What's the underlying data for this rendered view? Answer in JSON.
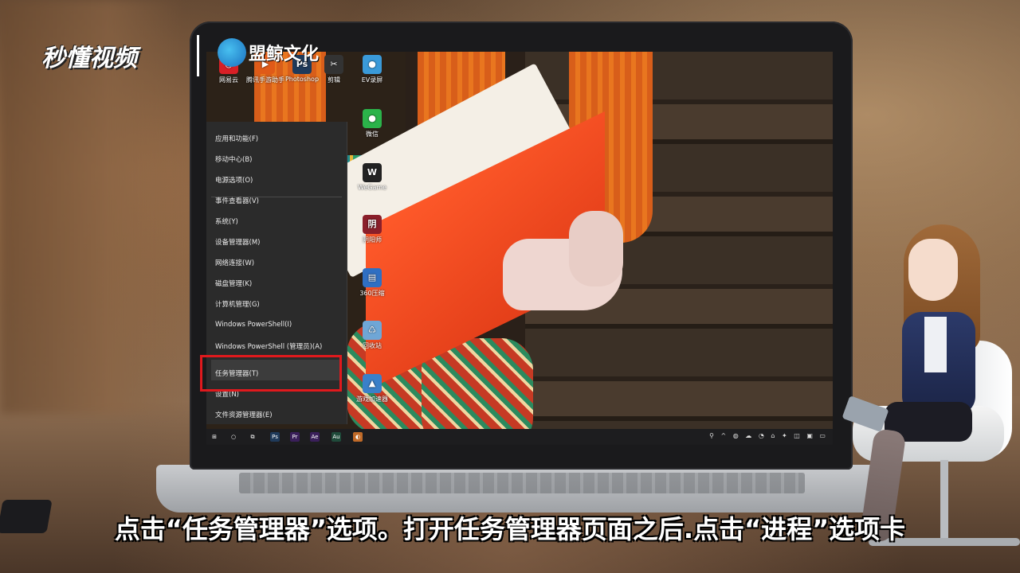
{
  "branding": {
    "logo_text": "秒懂视频",
    "partner_text": "盟鲸文化"
  },
  "desktop_icons": [
    {
      "label": "网易云",
      "glyph": "◎",
      "color": "#d81f26"
    },
    {
      "label": "腾讯手游助手",
      "glyph": "▶",
      "color": "#e05a18"
    },
    {
      "label": "Photoshop",
      "glyph": "Ps",
      "color": "#1f3a5a"
    },
    {
      "label": "剪辑",
      "glyph": "✂",
      "color": "#333333"
    },
    {
      "label": "EV录屏",
      "glyph": "●",
      "color": "#3a9ad9"
    },
    {
      "label": "微信",
      "glyph": "●",
      "color": "#2bb34a"
    },
    {
      "label": "WeGame",
      "glyph": "W",
      "color": "#222222"
    },
    {
      "label": "阴阳师",
      "glyph": "阴",
      "color": "#8a1f2a"
    },
    {
      "label": "360压缩",
      "glyph": "▤",
      "color": "#2f6fc2"
    },
    {
      "label": "回收站",
      "glyph": "♺",
      "color": "#6fa6d6"
    },
    {
      "label": "游戏加速器",
      "glyph": "▲",
      "color": "#3a80c9"
    }
  ],
  "context_menu": {
    "items": [
      {
        "label": "应用和功能(F)"
      },
      {
        "label": "移动中心(B)"
      },
      {
        "label": "电源选项(O)"
      },
      {
        "label": "事件查看器(V)"
      },
      {
        "label": "系统(Y)"
      },
      {
        "label": "设备管理器(M)"
      },
      {
        "label": "网络连接(W)"
      },
      {
        "label": "磁盘管理(K)"
      },
      {
        "label": "计算机管理(G)"
      },
      {
        "label": "Windows PowerShell(I)"
      },
      {
        "label": "Windows PowerShell (管理员)(A)"
      },
      {
        "label": "任务管理器(T)",
        "highlighted": true
      },
      {
        "label": "设置(N)"
      },
      {
        "label": "文件资源管理器(E)"
      }
    ]
  },
  "taskbar": {
    "apps": [
      {
        "name": "start",
        "glyph": "⊞",
        "color": "transparent"
      },
      {
        "name": "search",
        "glyph": "○",
        "color": "transparent"
      },
      {
        "name": "task-view",
        "glyph": "⧉",
        "color": "transparent"
      },
      {
        "name": "photoshop",
        "glyph": "Ps",
        "color": "#1f3a5a"
      },
      {
        "name": "premiere",
        "glyph": "Pr",
        "color": "#3a1f5a"
      },
      {
        "name": "after-effects",
        "glyph": "Ae",
        "color": "#3a1f5a"
      },
      {
        "name": "audition",
        "glyph": "Au",
        "color": "#1f4a3a"
      },
      {
        "name": "active-app",
        "glyph": "◐",
        "color": "#c06a28"
      }
    ],
    "tray_glyphs": "⚲ ^ ◍ ☁ ◔ ⌂ ✦ ◫ ▣ ▭"
  },
  "subtitle": "点击“任务管理器”选项。打开任务管理器页面之后.点击“进程”选项卡",
  "colors": {
    "highlight_box": "#e0191d",
    "menu_bg": "#2b2b2b",
    "taskbar_bg": "#1d1d1f"
  }
}
